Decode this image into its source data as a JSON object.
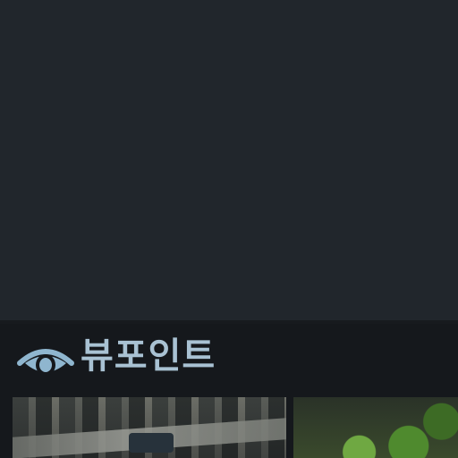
{
  "viewport_panel": {
    "title": "뷰포인트",
    "icon": "eye-icon",
    "thumbnails": [
      {
        "name": "viewpoint-thumbnail-1"
      },
      {
        "name": "viewpoint-thumbnail-2"
      }
    ]
  },
  "colors": {
    "background": "#21262c",
    "panel_background": "#15181c",
    "title_color": "#a9c2d3",
    "icon_color": "#8fb6cf"
  }
}
